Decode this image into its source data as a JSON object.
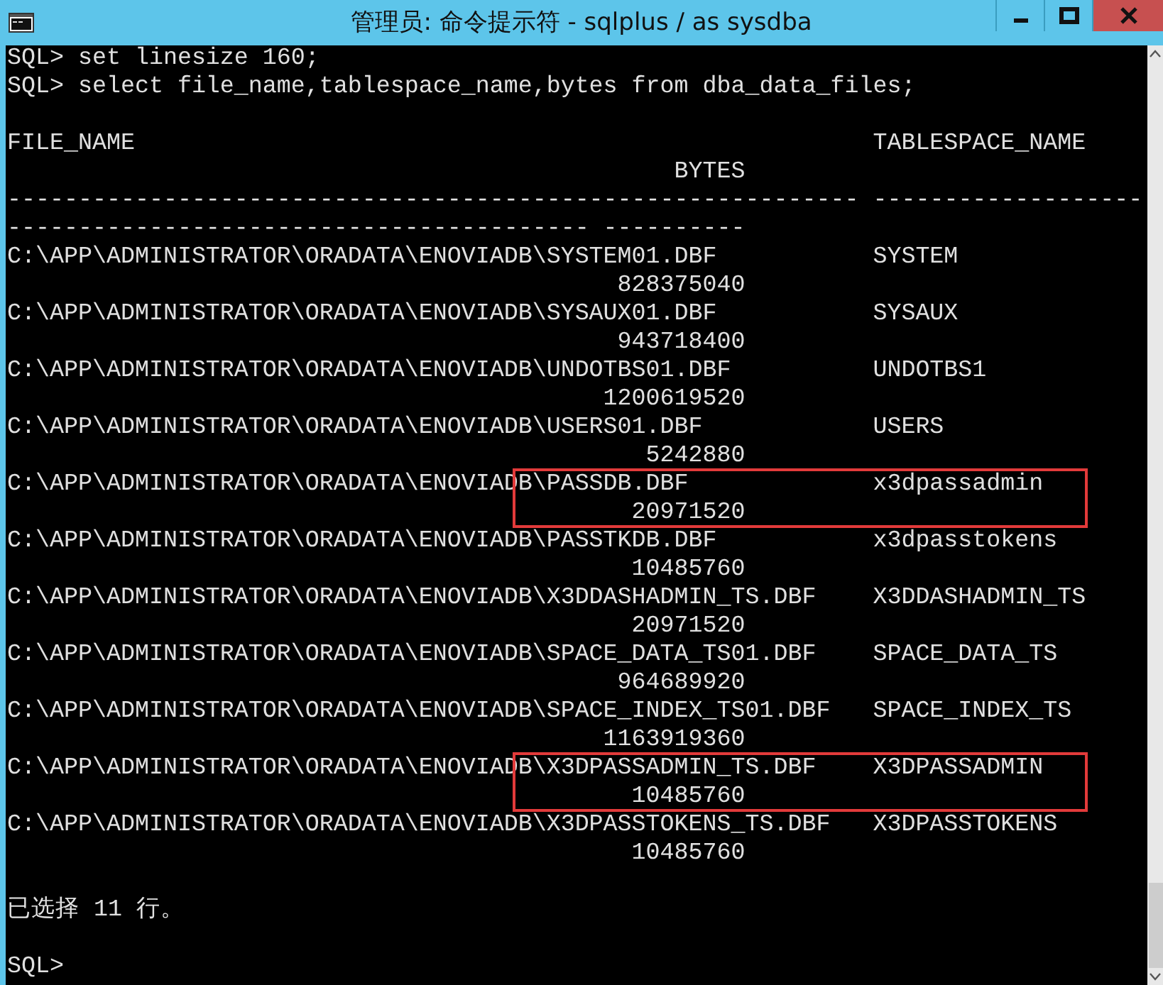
{
  "window": {
    "title": "管理员: 命令提示符 - sqlplus  / as sysdba"
  },
  "commands": [
    "SQL> set linesize 160;",
    "SQL> select file_name,tablespace_name,bytes from dba_data_files;"
  ],
  "columns": {
    "file_name": "FILE_NAME",
    "tablespace_name": "TABLESPACE_NAME",
    "bytes": "BYTES"
  },
  "separators": [
    "------------------------------------------------------------ -------------------",
    "----------------------------------------- ----------"
  ],
  "rows": [
    {
      "file_name": "C:\\APP\\ADMINISTRATOR\\ORADATA\\ENOVIADB\\SYSTEM01.DBF",
      "tablespace_name": "SYSTEM",
      "bytes": "828375040",
      "highlighted": false
    },
    {
      "file_name": "C:\\APP\\ADMINISTRATOR\\ORADATA\\ENOVIADB\\SYSAUX01.DBF",
      "tablespace_name": "SYSAUX",
      "bytes": "943718400",
      "highlighted": false
    },
    {
      "file_name": "C:\\APP\\ADMINISTRATOR\\ORADATA\\ENOVIADB\\UNDOTBS01.DBF",
      "tablespace_name": "UNDOTBS1",
      "bytes": "1200619520",
      "highlighted": false
    },
    {
      "file_name": "C:\\APP\\ADMINISTRATOR\\ORADATA\\ENOVIADB\\USERS01.DBF",
      "tablespace_name": "USERS",
      "bytes": "5242880",
      "highlighted": false
    },
    {
      "file_name": "C:\\APP\\ADMINISTRATOR\\ORADATA\\ENOVIADB\\PASSDB.DBF",
      "tablespace_name": "x3dpassadmin",
      "bytes": "20971520",
      "highlighted": true
    },
    {
      "file_name": "C:\\APP\\ADMINISTRATOR\\ORADATA\\ENOVIADB\\PASSTKDB.DBF",
      "tablespace_name": "x3dpasstokens",
      "bytes": "10485760",
      "highlighted": false
    },
    {
      "file_name": "C:\\APP\\ADMINISTRATOR\\ORADATA\\ENOVIADB\\X3DDASHADMIN_TS.DBF",
      "tablespace_name": "X3DDASHADMIN_TS",
      "bytes": "20971520",
      "highlighted": false
    },
    {
      "file_name": "C:\\APP\\ADMINISTRATOR\\ORADATA\\ENOVIADB\\SPACE_DATA_TS01.DBF",
      "tablespace_name": "SPACE_DATA_TS",
      "bytes": "964689920",
      "highlighted": false
    },
    {
      "file_name": "C:\\APP\\ADMINISTRATOR\\ORADATA\\ENOVIADB\\SPACE_INDEX_TS01.DBF",
      "tablespace_name": "SPACE_INDEX_TS",
      "bytes": "1163919360",
      "highlighted": false
    },
    {
      "file_name": "C:\\APP\\ADMINISTRATOR\\ORADATA\\ENOVIADB\\X3DPASSADMIN_TS.DBF",
      "tablespace_name": "X3DPASSADMIN",
      "bytes": "10485760",
      "highlighted": true
    },
    {
      "file_name": "C:\\APP\\ADMINISTRATOR\\ORADATA\\ENOVIADB\\X3DPASSTOKENS_TS.DBF",
      "tablespace_name": "X3DPASSTOKENS",
      "bytes": "10485760",
      "highlighted": false
    }
  ],
  "result_message": "已选择 11 行。",
  "prompt": "SQL>"
}
